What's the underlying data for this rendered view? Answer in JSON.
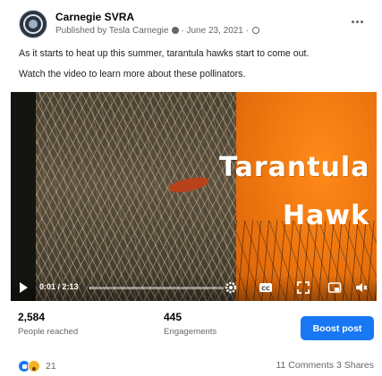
{
  "post": {
    "page_name": "Carnegie SVRA",
    "published_prefix": "Published by",
    "author": "Tesla Carnegie",
    "date": "June 23, 2021",
    "caption_line1": "As it starts to heat up this summer, tarantula hawks start to come out.",
    "caption_line2": "Watch the video to learn more about these pollinators."
  },
  "video": {
    "title_line1": "Tarantula",
    "title_line2": "Hawk",
    "timecode": "0:01 / 2:13",
    "progress": 0.008
  },
  "insights": {
    "people_reached_value": "2,584",
    "people_reached_label": "People reached",
    "engagements_value": "445",
    "engagements_label": "Engagements",
    "boost_label": "Boost post"
  },
  "footer": {
    "reaction_count": "21",
    "comments": "11 Comments",
    "shares": "3 Shares"
  },
  "colors": {
    "accent": "#1877f2",
    "secondary_text": "#65676b",
    "video_orange": "#f07810"
  },
  "icons": [
    "avatar",
    "info-icon",
    "globe-icon",
    "more-icon",
    "play-icon",
    "settings-icon",
    "cc-icon",
    "expand-icon",
    "pip-icon",
    "volume-icon",
    "like-icon",
    "wow-icon"
  ]
}
